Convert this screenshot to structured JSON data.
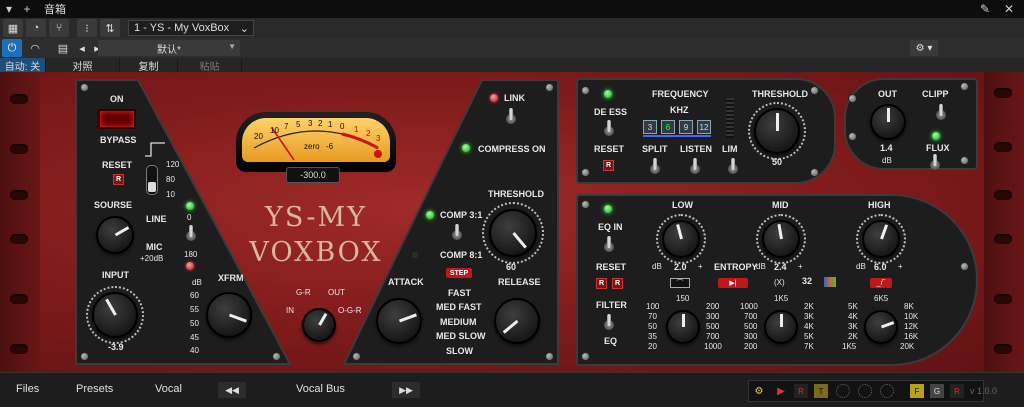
{
  "window": {
    "title": "音箱",
    "instance": "1 - YS - My VoxBox"
  },
  "toolbar": {
    "preset_name": "默认*",
    "row3": [
      "自动: 关",
      "对照",
      "复制",
      "粘贴"
    ]
  },
  "brand": {
    "line1": "YS-MY",
    "line2": "VOXBOX"
  },
  "left": {
    "on": "ON",
    "bypass": "BYPASS",
    "reset": "RESET",
    "reset_btn": "R",
    "hpf_vals": [
      "120",
      "80",
      "10"
    ],
    "hpf_zero": "0",
    "hpf_180": "180",
    "source": "SOURSE",
    "line": "LINE",
    "mic": "MIC",
    "mic_gain": "+20dB",
    "input": "INPUT",
    "input_value": "-3.9",
    "db": "dB",
    "xfrm": "XFRM",
    "xfrm_vals": [
      "60",
      "55",
      "50",
      "45",
      "40"
    ]
  },
  "meter": {
    "scale": [
      "20",
      "10",
      "7",
      "5",
      "3",
      "2",
      "1",
      "0",
      "1",
      "2",
      "3"
    ],
    "zero_label": "zero",
    "minus6": "-6",
    "readout": "-300.0",
    "gr_labels": {
      "gr": "G-R",
      "out": "OUT",
      "in": "IN",
      "ogr": "O-G-R"
    }
  },
  "comp": {
    "link": "LINK",
    "compress_on": "COMPRESS ON",
    "threshold": "THRESHOLD",
    "threshold_value": "60",
    "comp31": "COMP 3:1",
    "comp81": "COMP 8:1",
    "step": "STEP",
    "attack": "ATTACK",
    "release": "RELEASE",
    "speeds": [
      "FAST",
      "MED FAST",
      "MEDIUM",
      "MED SLOW",
      "SLOW"
    ]
  },
  "deess": {
    "de_ess": "DE ESS",
    "reset": "RESET",
    "reset_btn": "R",
    "frequency": "FREQUENCY",
    "khz": "KHZ",
    "khz_vals": [
      "3",
      "6",
      "9",
      "12"
    ],
    "split": "SPLIT",
    "listen": "LISTEN",
    "lim": "LIM",
    "threshold": "THRESHOLD",
    "threshold_value": "50"
  },
  "output": {
    "out": "OUT",
    "value": "1.4",
    "unit": "dB",
    "clipp": "CLIPP",
    "flux": "FLUX"
  },
  "eq": {
    "eq_in": "EQ IN",
    "reset": "RESET",
    "r": "R",
    "filter": "FILTER",
    "eq": "EQ",
    "low": "LOW",
    "low_val": "2.0",
    "mid": "MID",
    "mid_val": "2.4",
    "high": "HIGH",
    "high_val": "6.0",
    "db": "dB",
    "plus": "+",
    "entropy": "ENTROPY",
    "entropy_val": "32",
    "entropy_x": "(X)",
    "filter_freqs_l": [
      "100",
      "70",
      "50",
      "35",
      "20"
    ],
    "filter_top": "150",
    "filter_freqs_r": [
      "200",
      "300",
      "500",
      "700",
      "1000"
    ],
    "mid_freqs_l": [
      "1000",
      "700",
      "500",
      "300",
      "200"
    ],
    "mid_top": "1K5",
    "mid_freqs_r": [
      "2K",
      "3K",
      "4K",
      "5K",
      "7K"
    ],
    "high_freqs_l": [
      "5K",
      "4K",
      "3K",
      "2K",
      "1K5"
    ],
    "high_top": "6K5",
    "high_freqs_r": [
      "8K",
      "10K",
      "12K",
      "16K",
      "20K"
    ]
  },
  "footer": {
    "files": "Files",
    "presets": "Presets",
    "preset_name": "Vocal",
    "bus": "Vocal Bus",
    "version": "v 1.0.0"
  }
}
